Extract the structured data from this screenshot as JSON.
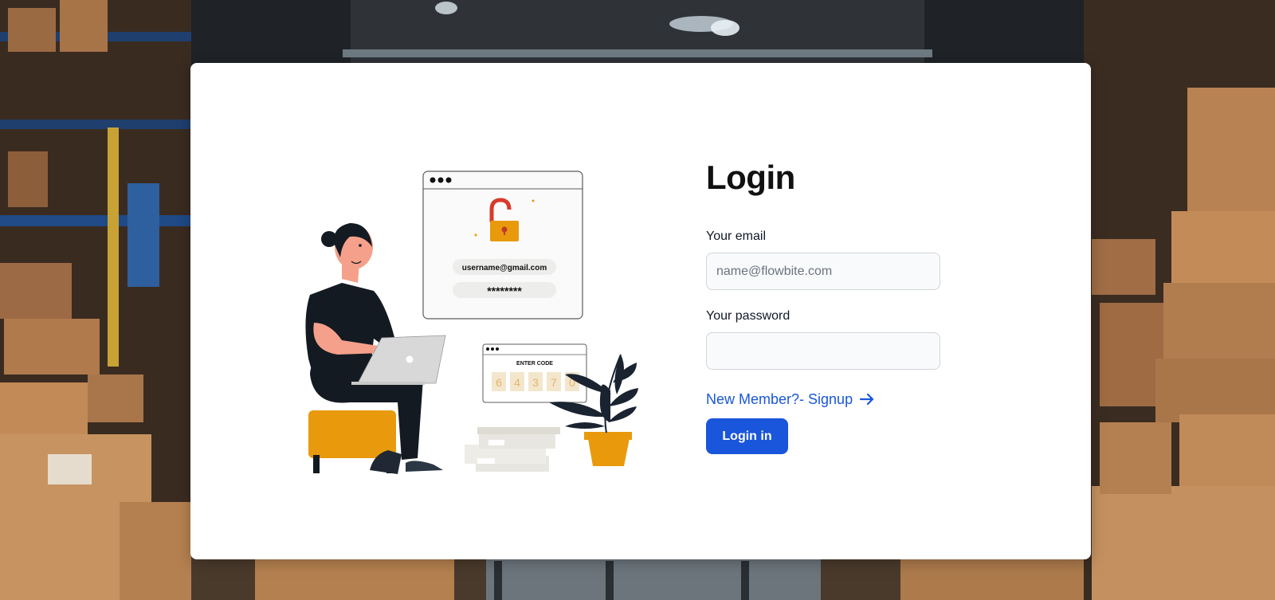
{
  "background": {
    "scene": "warehouse-photo"
  },
  "illustration": {
    "browser_email": "username@gmail.com",
    "browser_password": "********",
    "code_title": "ENTER CODE",
    "code_digits": [
      "6",
      "4",
      "3",
      "7",
      "0"
    ]
  },
  "form": {
    "title": "Login",
    "email_label": "Your email",
    "email_placeholder": "name@flowbite.com",
    "email_value": "",
    "password_label": "Your password",
    "password_value": "",
    "signup_link": "New Member?- Signup",
    "submit_label": "Login in"
  },
  "colors": {
    "accent": "#1a56db",
    "card": "#ffffff",
    "field_bg": "#f9fafb",
    "illustration_orange": "#e89a0c",
    "illustration_dark": "#141a22",
    "lock_red": "#d93a2b"
  },
  "icons": {
    "signup_arrow": "arrow-right-icon",
    "lock": "unlocked-padlock-icon"
  }
}
